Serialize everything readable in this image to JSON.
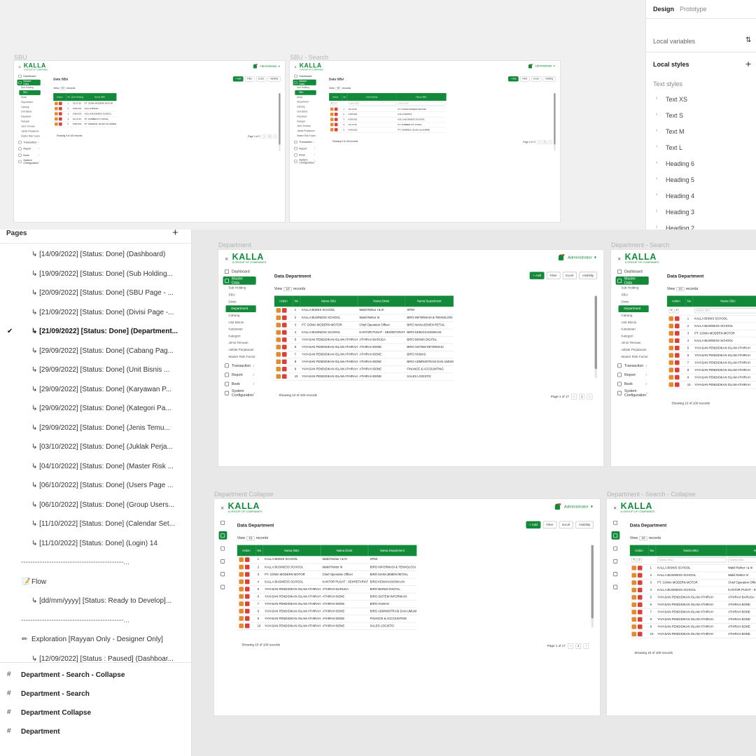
{
  "figma": {
    "tabs": {
      "design": "Design",
      "prototype": "Prototype"
    },
    "local_variables": "Local variables",
    "local_styles": "Local styles",
    "text_styles_label": "Text styles",
    "text_styles": [
      "Text XS",
      "Text S",
      "Text M",
      "Text L",
      "Heading 6",
      "Heading 5",
      "Heading 4",
      "Heading 3",
      "Heading 2"
    ],
    "pages_title": "Pages",
    "pages": [
      "↳ [14/09/2022] [Status: Done] (Dashboard)",
      "↳ [19/09/2022] [Status: Done] (Sub Holding...",
      "↳ [20/09/2022] [Status: Done] (SBU Page - ...",
      "↳ [21/09/2022] [Status: Done] (Divisi Page -...",
      "↳ [21/09/2022] [Status: Done] (Department...",
      "↳ [29/09/2022] [Status: Done] (Cabang Pag...",
      "↳ [29/09/2022] [Status: Done] (Unit Bisnis ...",
      "↳ [29/09/2022] [Status: Done] (Karyawan P...",
      "↳ [29/09/2022] [Status: Done] (Kategori Pa...",
      "↳ [29/09/2022] [Status: Done] (Jenis Temu...",
      "↳ [03/10/2022] [Status: Done] (Juklak Perja...",
      "↳ [04/10/2022] [Status: Done] (Master Risk ...",
      "↳ [06/10/2022] [Status: Done] (Users Page ...",
      "↳ [06/10/2022] [Status: Done] (Group Users...",
      "↳ [11/10/2022] [Status: Done] (Calendar Set...",
      "↳ [11/10/2022] [Status: Done] (Login) 14",
      "--------------------------------------------...",
      "Flow",
      "↳ [dd/mm/yyyy] [Status:  Ready to Develop]...",
      "--------------------------------------------...",
      "Exploration [Rayyan Only - Designer Only]",
      "↳ [12/09/2022] [Status : Paused] (Dashboar..."
    ],
    "layers": [
      "Department - Search - Collapse",
      "Department - Search",
      "Department Collapse",
      "Department"
    ]
  },
  "frames": {
    "sbu": "SBU",
    "sbu_search": "SBU - Search",
    "department": "Department",
    "department_search": "Department - Search",
    "department_collapse": "Department Collapse",
    "department_search_collapse": "Department - Search - Collapse"
  },
  "app": {
    "logo": "KALLA",
    "logo_tagline": "A GROUP OF COMPANIES",
    "user": "Administrator",
    "sidebar": {
      "dashboard": "Dashboard",
      "master_data": "Master Data",
      "sub_items": [
        "Sub Holding",
        "SBU",
        "Divisi",
        "Department",
        "Cabang",
        "Unit Bisnis",
        "Karyawan",
        "Kategori",
        "Jenis Temuan",
        "Juklak Perjalanan",
        "Master Risk Factor"
      ],
      "transaction": "Transaction",
      "report": "Report",
      "book": "Book",
      "system_configuration": "System Configuration"
    },
    "buttons": {
      "add": "+ Add",
      "filter": "Filter",
      "excel": "Excel",
      "visibility": "Visibility"
    },
    "view": {
      "prefix": "View",
      "value": "10",
      "suffix": "records"
    },
    "search_placeholder": "Nama SBU",
    "action_header": "Action",
    "no_header": "No",
    "sbu_page": {
      "title": "Data SBU",
      "columns": [
        "Sub Holding",
        "Nama SBU"
      ],
      "rows": [
        [
          "GO 0710",
          "PT. GOWA MODERN MOTOR"
        ],
        [
          "KOM 001",
          "KALLA BISNIS"
        ],
        [
          "KOM 002",
          "KALLA BUSINESS SCHOOL"
        ],
        [
          "GO 0710",
          "PT. SUMBER FIT CONAL"
        ],
        [
          "KOM 002",
          "PT. GENERAL ISLAM JULANREE"
        ]
      ],
      "showing": "Showing 5 of 100 records",
      "pager": "Page 1 of 17"
    },
    "dept_page": {
      "title": "Data Department",
      "columns": [
        "Nama SBU",
        "Nama Divisi",
        "Nama Department"
      ],
      "rows": [
        [
          "KALLA BISNIS SCHOOL",
          "Wakil Rektor I & III",
          "SPMI"
        ],
        [
          "KALLA BUSINESS SCHOOL",
          "Wakil Rektor III",
          "BIRO INFORMASI & TEKNOLOGI"
        ],
        [
          "PT. GOWA MODERN MOTOR",
          "Chief Operation Officer",
          "BIRO MANAJEMEN RETAIL"
        ],
        [
          "KALLA BUSINESS SCHOOL",
          "KANTOR PUSAT - SEKRETARIAT",
          "BIRO KEMAHASISWAAN"
        ],
        [
          "YAYASAN PENDIDIKAN ISLAM ATHIRAH",
          "ATHIRAH BARUGA",
          "BIRO BISNIS DIGITAL"
        ],
        [
          "YAYASAN PENDIDIKAN ISLAM ATHIRAH",
          "ATHIRAH BONE",
          "BIRO SISTEM INFORMASI"
        ],
        [
          "YAYASAN PENDIDIKAN ISLAM ATHIRAH",
          "ATHIRAH BONE",
          "BIRO HUMAS"
        ],
        [
          "YAYASAN PENDIDIKAN ISLAM ATHIRAH",
          "ATHIRAH BONE",
          "BIRO ADMINISTRASI DAN UMUM"
        ],
        [
          "YAYASAN PENDIDIKAN ISLAM ATHIRAH",
          "ATHIRAH BONE",
          "FINANCE & ACCOUNTING"
        ],
        [
          "YAYASAN PENDIDIKAN ISLAM ATHIRAH",
          "ATHIRAH BONE",
          "SALES LOGISTIC"
        ]
      ],
      "showing": "Showing 10 of 100 records",
      "pager": "Page 1 of 17",
      "page_num": "1"
    }
  }
}
